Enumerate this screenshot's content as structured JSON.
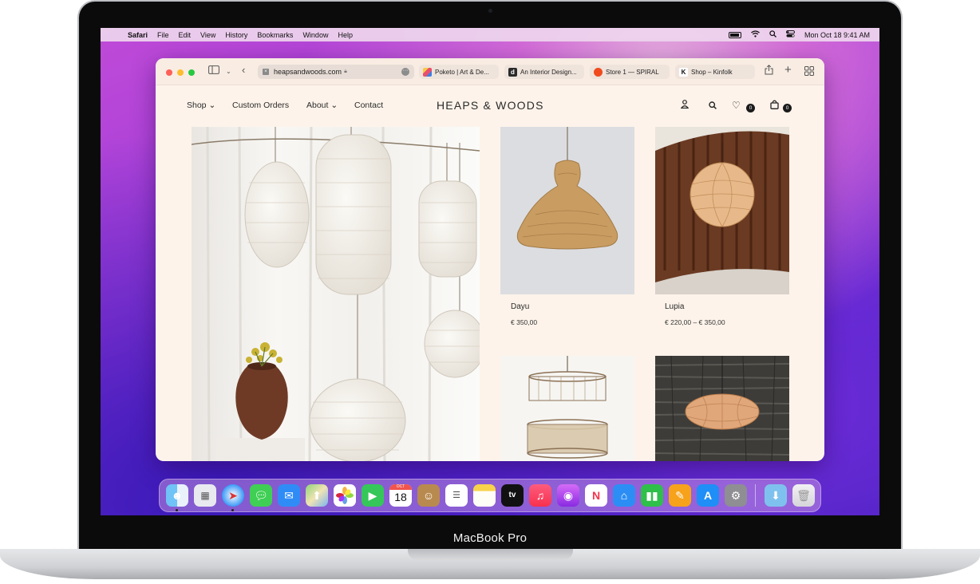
{
  "device_label": "MacBook Pro",
  "menubar": {
    "app_name": "Safari",
    "items": [
      "File",
      "Edit",
      "View",
      "History",
      "Bookmarks",
      "Window",
      "Help"
    ],
    "datetime": "Mon Oct 18  9:41 AM"
  },
  "browser": {
    "url": "heapsandwoods.com",
    "tabs": [
      {
        "label": "Poketo | Art & De...",
        "favicon": "P"
      },
      {
        "label": "An Interior Design...",
        "favicon": "d"
      },
      {
        "label": "Store 1 — SPIRAL",
        "favicon": ""
      },
      {
        "label": "Shop – Kinfolk",
        "favicon": "K"
      }
    ]
  },
  "site": {
    "logo": "HEAPS & WOODS",
    "nav": {
      "shop": "Shop",
      "custom_orders": "Custom Orders",
      "about": "About",
      "contact": "Contact"
    },
    "wishlist_count": "0",
    "cart_count": "0",
    "products": [
      {
        "name": "Dayu",
        "price": "€ 350,00"
      },
      {
        "name": "Lupia",
        "price": "€ 220,00 – € 350,00"
      }
    ]
  },
  "dock": {
    "calendar_month": "OCT",
    "calendar_day": "18",
    "tv_label": "tv"
  }
}
